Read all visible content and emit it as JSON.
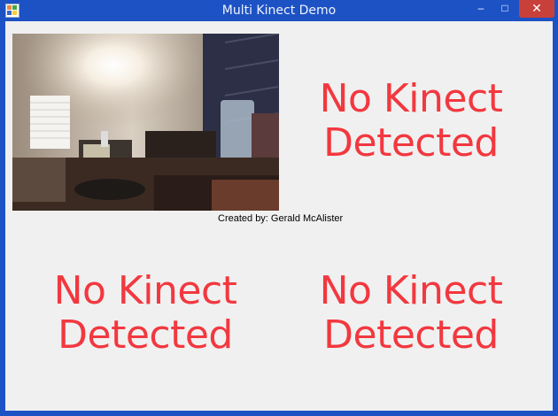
{
  "window": {
    "title": "Multi Kinect Demo",
    "controls": {
      "minimize": "–",
      "maximize": "□",
      "close": "✕"
    }
  },
  "panels": [
    {
      "type": "camera-feed"
    },
    {
      "line1": "No Kinect",
      "line2": "Detected"
    },
    {
      "line1": "No Kinect",
      "line2": "Detected"
    },
    {
      "line1": "No Kinect",
      "line2": "Detected"
    }
  ],
  "credit": "Created by: Gerald McAlister",
  "colors": {
    "accent": "#f2383f",
    "titlebar": "#1d52c4",
    "close": "#c8403a"
  }
}
